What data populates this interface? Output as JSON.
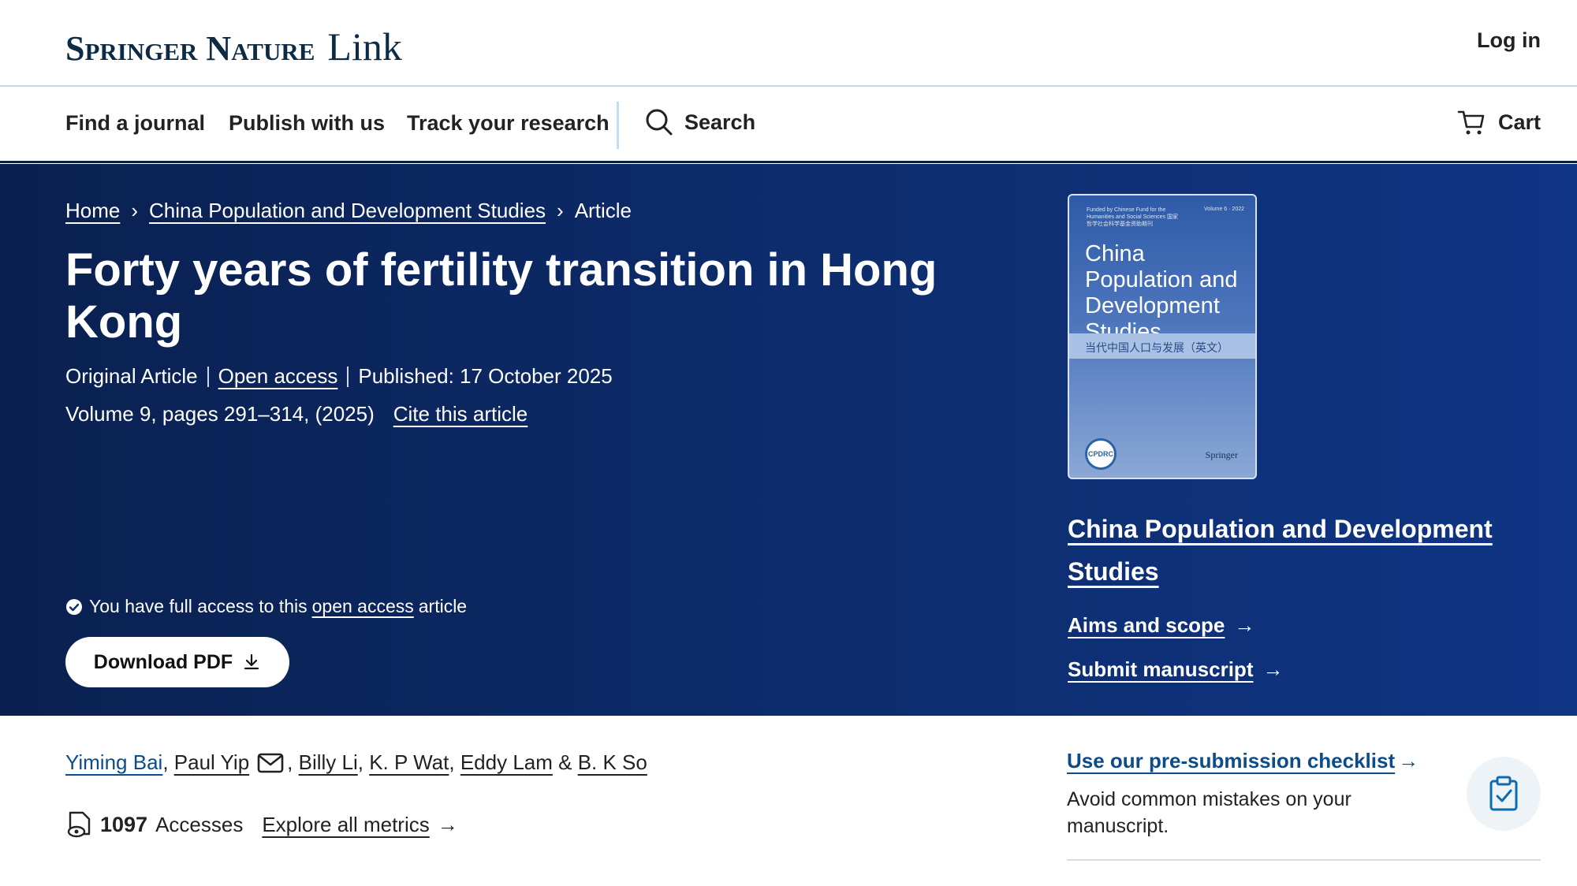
{
  "header": {
    "brand_main": "Springer Nature",
    "brand_link": "Link",
    "login_label": "Log in"
  },
  "nav": {
    "find_journal": "Find a journal",
    "publish": "Publish with us",
    "track": "Track your research",
    "search": "Search",
    "cart": "Cart"
  },
  "breadcrumb": {
    "home": "Home",
    "journal": "China Population and Development Studies",
    "current": "Article"
  },
  "article": {
    "title": "Forty years of fertility transition in Hong Kong",
    "type": "Original Article",
    "open_access": "Open access",
    "published": "Published: 17 October 2025",
    "volume": "Volume 9, pages 291–314, (2025)",
    "cite": "Cite this article"
  },
  "access_notice": {
    "prefix": "You have full access to this",
    "link": "open access",
    "suffix": "article"
  },
  "download_label": "Download PDF",
  "cover": {
    "funding_text": "Funded by Chinese Fund for the Humanities and Social Sciences 国家哲学社会科学基金资助期刊",
    "volume_text": "Volume 6 · 2022",
    "title": "China Population and Development Studies",
    "chinese_title": "当代中国人口与发展（英文）",
    "seal": "CPDRC",
    "publisher": "Springer"
  },
  "journal_panel": {
    "name": "China Population and Development Studies",
    "aims": "Aims and scope",
    "submit": "Submit manuscript"
  },
  "authors": [
    {
      "name": "Yiming Bai"
    },
    {
      "name": "Paul Yip"
    },
    {
      "name": "Billy Li"
    },
    {
      "name": "K. P Wat"
    },
    {
      "name": "Eddy Lam"
    },
    {
      "name": "B. K So"
    }
  ],
  "metrics": {
    "count": "1097",
    "label": "Accesses",
    "explore": "Explore all metrics"
  },
  "checklist": {
    "title": "Use our pre-submission checklist",
    "desc": "Avoid common mistakes on your manuscript."
  },
  "colors": {
    "hero_bg": "#0d2d6e",
    "brand_text": "#0d2b45",
    "link_blue": "#0c4c8a"
  }
}
